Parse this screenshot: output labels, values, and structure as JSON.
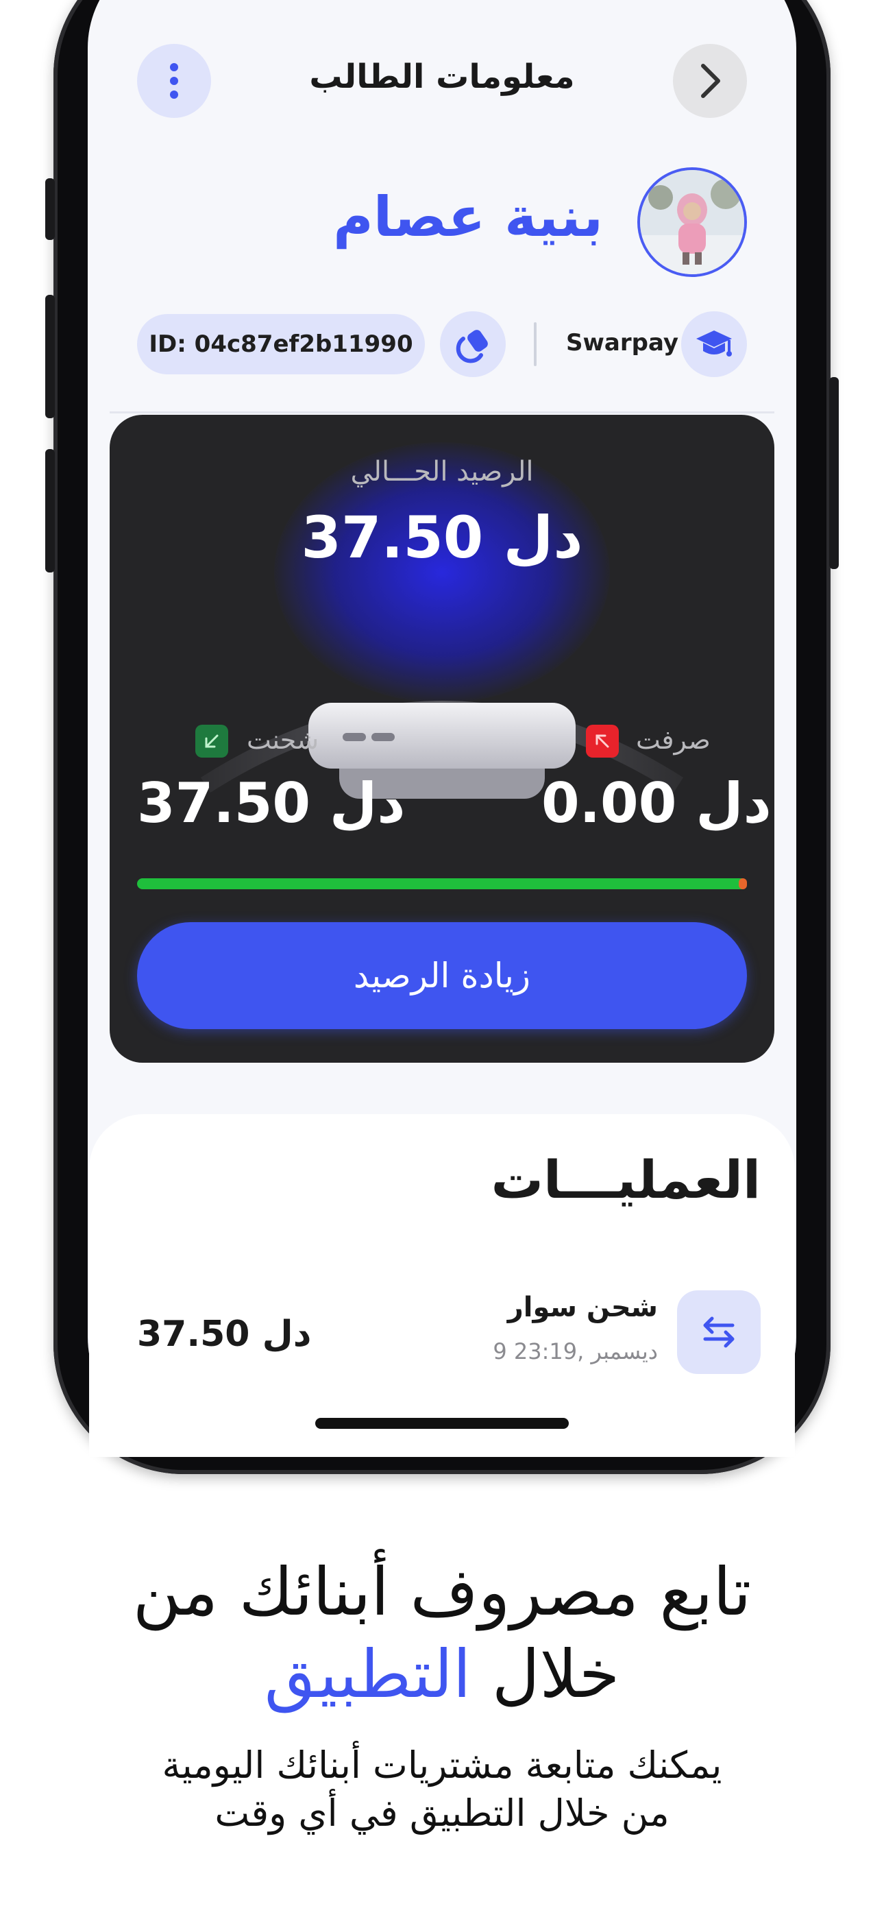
{
  "header": {
    "title": "معلومات الطالب"
  },
  "student": {
    "name": "بنية عصام",
    "id_label": "ID: 04c87ef2b11990",
    "school": "Swarpay"
  },
  "balance": {
    "label": "الرصيد الحـــالي",
    "amount": "37.50 دل",
    "charged_label": "شحنت",
    "charged_amount": "37.50 دل",
    "spent_label": "صرفت",
    "spent_amount": "0.00 دل",
    "spent_fraction": 0.0,
    "topup_button": "زيادة الرصيد"
  },
  "operations": {
    "title": "العمليـــات",
    "items": [
      {
        "title": "شحن سوار",
        "datetime": "9 ديسمبر ,23:19",
        "amount": "37.50 دل"
      }
    ]
  },
  "marketing": {
    "headline_line1": "تابع مصروف أبنائك من",
    "headline_line2_plain": "خلال",
    "headline_line2_accent": "التطبيق",
    "sub_line1": "يمكنك متابعة مشتريات أبنائك اليومية",
    "sub_line2": "من خلال التطبيق في أي  وقت"
  },
  "colors": {
    "accent": "#3f55f0",
    "card_bg": "#252527",
    "progress_green": "#1fbf3c",
    "spent_red": "#e8232b",
    "charged_green": "#1e7a3e"
  }
}
